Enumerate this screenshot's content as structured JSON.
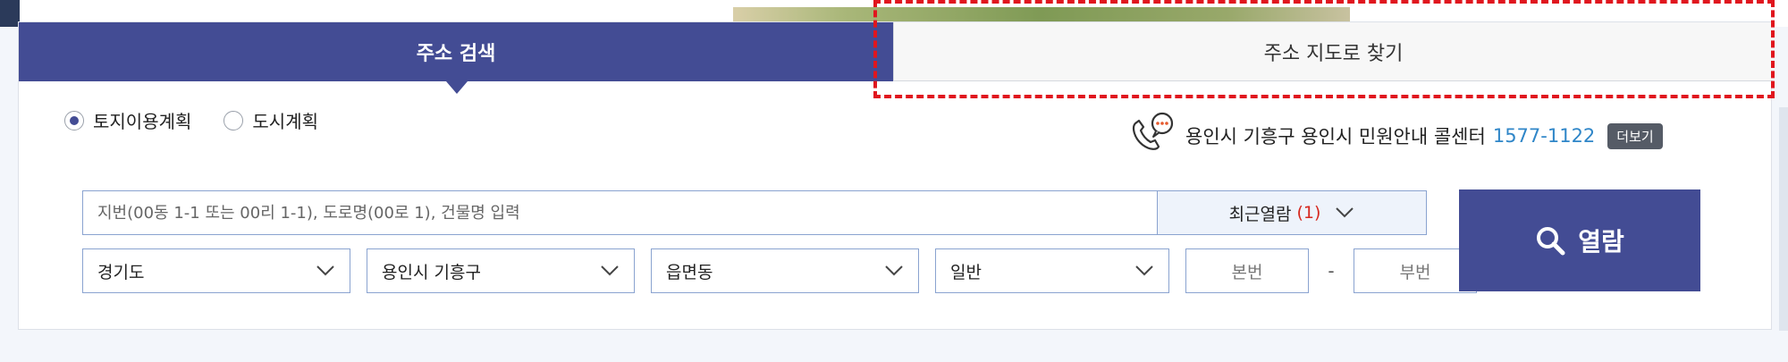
{
  "tabs": [
    {
      "label": "주소 검색",
      "active": true
    },
    {
      "label": "주소 지도로 찾기",
      "active": false
    }
  ],
  "radios": [
    {
      "label": "토지이용계획",
      "checked": true
    },
    {
      "label": "도시계획",
      "checked": false
    }
  ],
  "callcenter": {
    "text": "용인시 기흥구 용인시 민원안내 콜센터",
    "number": "1577-1122",
    "more_label": "더보기",
    "icon": "phone-chat-icon"
  },
  "search": {
    "placeholder": "지번(00동 1-1 또는 00리 1-1), 도로명(00로 1), 건물명 입력",
    "value": "",
    "recent_label": "최근열람",
    "recent_count": "(1)"
  },
  "selects": {
    "province": "경기도",
    "city": "용인시 기흥구",
    "town": "읍면동",
    "type": "일반"
  },
  "lot": {
    "main_placeholder": "본번",
    "separator": "-",
    "sub_placeholder": "부번"
  },
  "view_button": {
    "label": "열람",
    "icon": "search-icon"
  },
  "colors": {
    "accent": "#434c94",
    "highlight": "#e0161e",
    "phone_number": "#2f86c8",
    "recent_count": "#d6281f"
  }
}
